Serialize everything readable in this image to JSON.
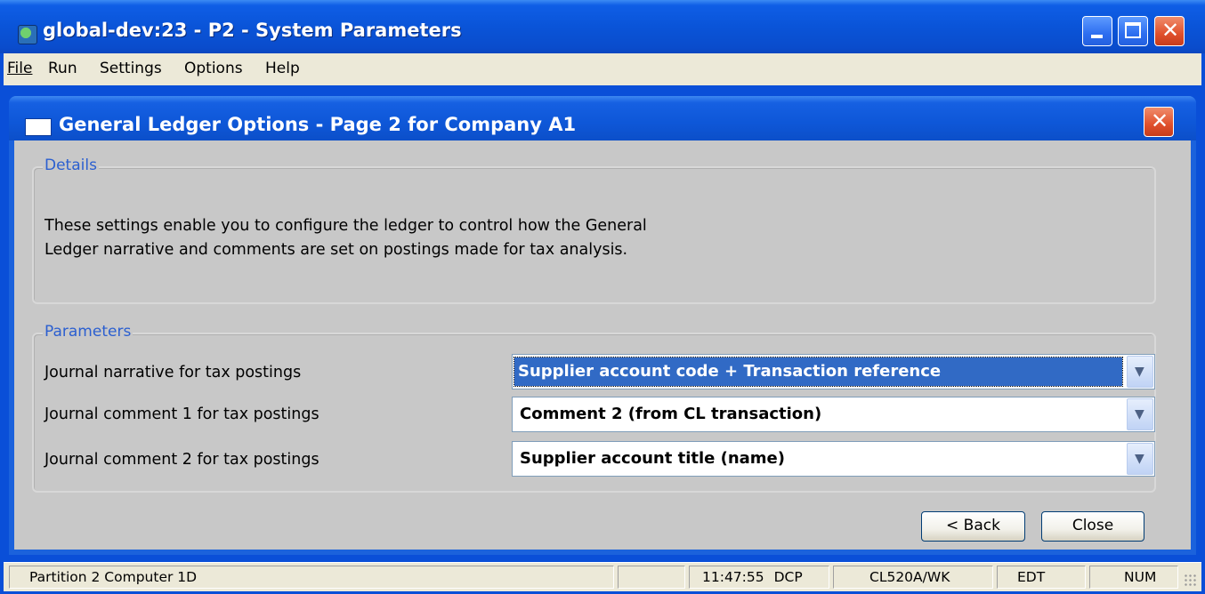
{
  "window": {
    "title": "global-dev:23 - P2 - System Parameters",
    "icon": "app-globe-icon",
    "controls": [
      "minimize-icon",
      "maximize-icon",
      "close-icon"
    ]
  },
  "menubar": {
    "items": [
      {
        "label": "File",
        "mnemonic": "F"
      },
      {
        "label": "Run",
        "mnemonic": "R"
      },
      {
        "label": "Settings",
        "mnemonic": "S"
      },
      {
        "label": "Options",
        "mnemonic": "O"
      },
      {
        "label": "Help",
        "mnemonic": "H"
      }
    ]
  },
  "dialog": {
    "title": "General Ledger Options - Page 2 for Company A1",
    "details": {
      "heading": "Details",
      "line1": "These settings enable you to configure the ledger to control how the General",
      "line2": "Ledger narrative and comments are set on postings made for tax analysis."
    },
    "parameters": {
      "heading": "Parameters",
      "rows": [
        {
          "label": "Journal narrative for tax postings",
          "value": "Supplier account code + Transaction reference",
          "focused": true
        },
        {
          "label": "Journal comment 1 for tax postings",
          "value": "Comment 2 (from CL transaction)",
          "focused": false
        },
        {
          "label": "Journal comment 2 for tax postings",
          "value": "Supplier account title (name)",
          "focused": false
        }
      ]
    },
    "buttons": {
      "back": "< Back",
      "close": "Close"
    }
  },
  "statusbar": {
    "location": "Partition 2 Computer 1D",
    "blank": "",
    "time": "11:47:55",
    "mode": "DCP",
    "program": "CL520A/WK",
    "edit": "EDT",
    "num": "NUM"
  },
  "colors": {
    "titlebar": "#0a54d8",
    "dialog_bg": "#c8c8c8",
    "group_label": "#2b5fd0",
    "selection": "#316ac5"
  }
}
